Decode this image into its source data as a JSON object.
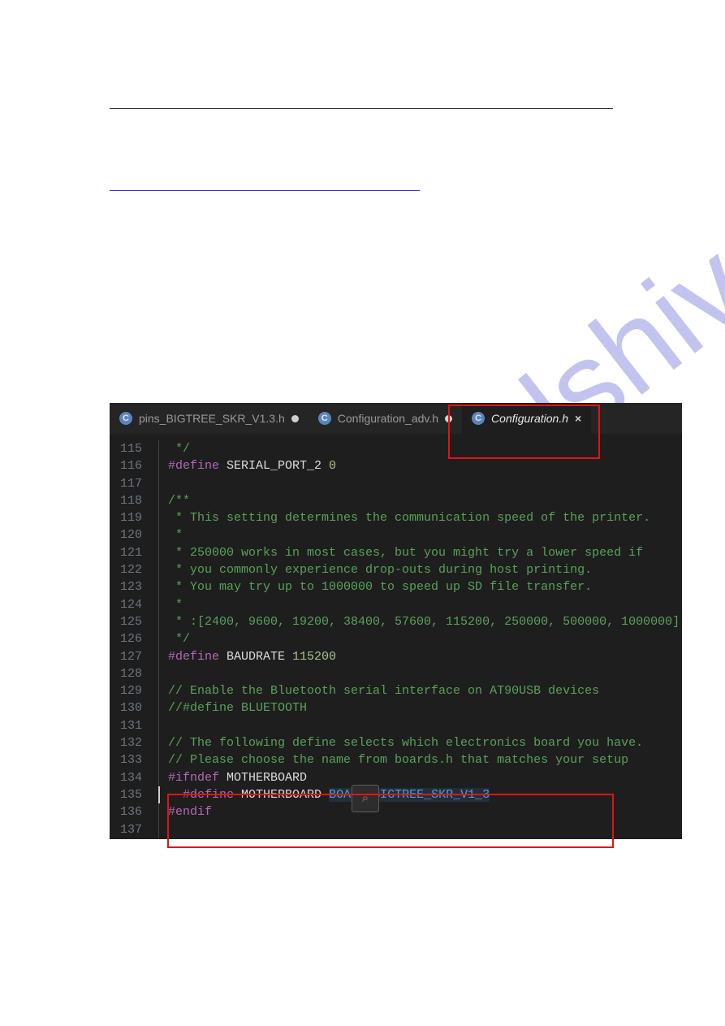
{
  "page": {},
  "link": {},
  "editor": {
    "tabs": [
      {
        "badge": "C",
        "filename": "pins_BIGTREE_SKR_V1.3.h",
        "dirty": true,
        "active": false,
        "closeable": false
      },
      {
        "badge": "C",
        "filename": "Configuration_adv.h",
        "dirty": true,
        "active": false,
        "closeable": false
      },
      {
        "badge": "C",
        "filename": "Configuration.h",
        "dirty": false,
        "active": true,
        "closeable": true
      }
    ],
    "highlighted_tab_index": 2,
    "lines": [
      {
        "num": 115,
        "segments": [
          {
            "cls": "tok-comment",
            "t": " */"
          }
        ]
      },
      {
        "num": 116,
        "segments": [
          {
            "cls": "tok-pre",
            "t": "#define"
          },
          {
            "cls": "tok-white",
            "t": " SERIAL_PORT_2 "
          },
          {
            "cls": "tok-num",
            "t": "0"
          }
        ]
      },
      {
        "num": 117,
        "segments": []
      },
      {
        "num": 118,
        "segments": [
          {
            "cls": "tok-comment",
            "t": "/**"
          }
        ]
      },
      {
        "num": 119,
        "segments": [
          {
            "cls": "tok-comment",
            "t": " * This setting determines the communication speed of the printer."
          }
        ]
      },
      {
        "num": 120,
        "segments": [
          {
            "cls": "tok-comment",
            "t": " *"
          }
        ]
      },
      {
        "num": 121,
        "segments": [
          {
            "cls": "tok-comment",
            "t": " * 250000 works in most cases, but you might try a lower speed if"
          }
        ]
      },
      {
        "num": 122,
        "segments": [
          {
            "cls": "tok-comment",
            "t": " * you commonly experience drop-outs during host printing."
          }
        ]
      },
      {
        "num": 123,
        "segments": [
          {
            "cls": "tok-comment",
            "t": " * You may try up to 1000000 to speed up SD file transfer."
          }
        ]
      },
      {
        "num": 124,
        "segments": [
          {
            "cls": "tok-comment",
            "t": " *"
          }
        ]
      },
      {
        "num": 125,
        "segments": [
          {
            "cls": "tok-comment",
            "t": " * :[2400, 9600, 19200, 38400, 57600, 115200, 250000, 500000, 1000000]"
          }
        ]
      },
      {
        "num": 126,
        "segments": [
          {
            "cls": "tok-comment",
            "t": " */"
          }
        ]
      },
      {
        "num": 127,
        "segments": [
          {
            "cls": "tok-pre",
            "t": "#define"
          },
          {
            "cls": "tok-white",
            "t": " BAUDRATE "
          },
          {
            "cls": "tok-num",
            "t": "115200"
          }
        ]
      },
      {
        "num": 128,
        "segments": []
      },
      {
        "num": 129,
        "segments": [
          {
            "cls": "tok-comment",
            "t": "// Enable the Bluetooth serial interface on AT90USB devices"
          }
        ]
      },
      {
        "num": 130,
        "segments": [
          {
            "cls": "tok-comment",
            "t": "//#define BLUETOOTH"
          }
        ]
      },
      {
        "num": 131,
        "segments": []
      },
      {
        "num": 132,
        "segments": [
          {
            "cls": "tok-comment",
            "t": "// The following define selects which electronics board you have."
          }
        ]
      },
      {
        "num": 133,
        "segments": [
          {
            "cls": "tok-comment",
            "t": "// Please choose the name from boards.h that matches your setup"
          }
        ]
      },
      {
        "num": 134,
        "segments": [
          {
            "cls": "tok-pre",
            "t": "#ifndef"
          },
          {
            "cls": "tok-white",
            "t": " MOTHERBOARD"
          }
        ]
      },
      {
        "num": 135,
        "segments": [
          {
            "cls": "tok-white",
            "t": "  "
          },
          {
            "cls": "tok-pre",
            "t": "#define"
          },
          {
            "cls": "tok-white",
            "t": " MOTHERBOARD "
          },
          {
            "cls": "tok-sel",
            "t": "BOARD_BIGTREE_SKR_V1_3"
          }
        ]
      },
      {
        "num": 136,
        "segments": [
          {
            "cls": "tok-pre",
            "t": "#endif"
          }
        ]
      },
      {
        "num": 137,
        "segments": []
      }
    ],
    "highlight_box_lines": [
      134,
      136
    ]
  },
  "watermark_text": "manualshive.com",
  "find_icon_glyph": "⌕"
}
